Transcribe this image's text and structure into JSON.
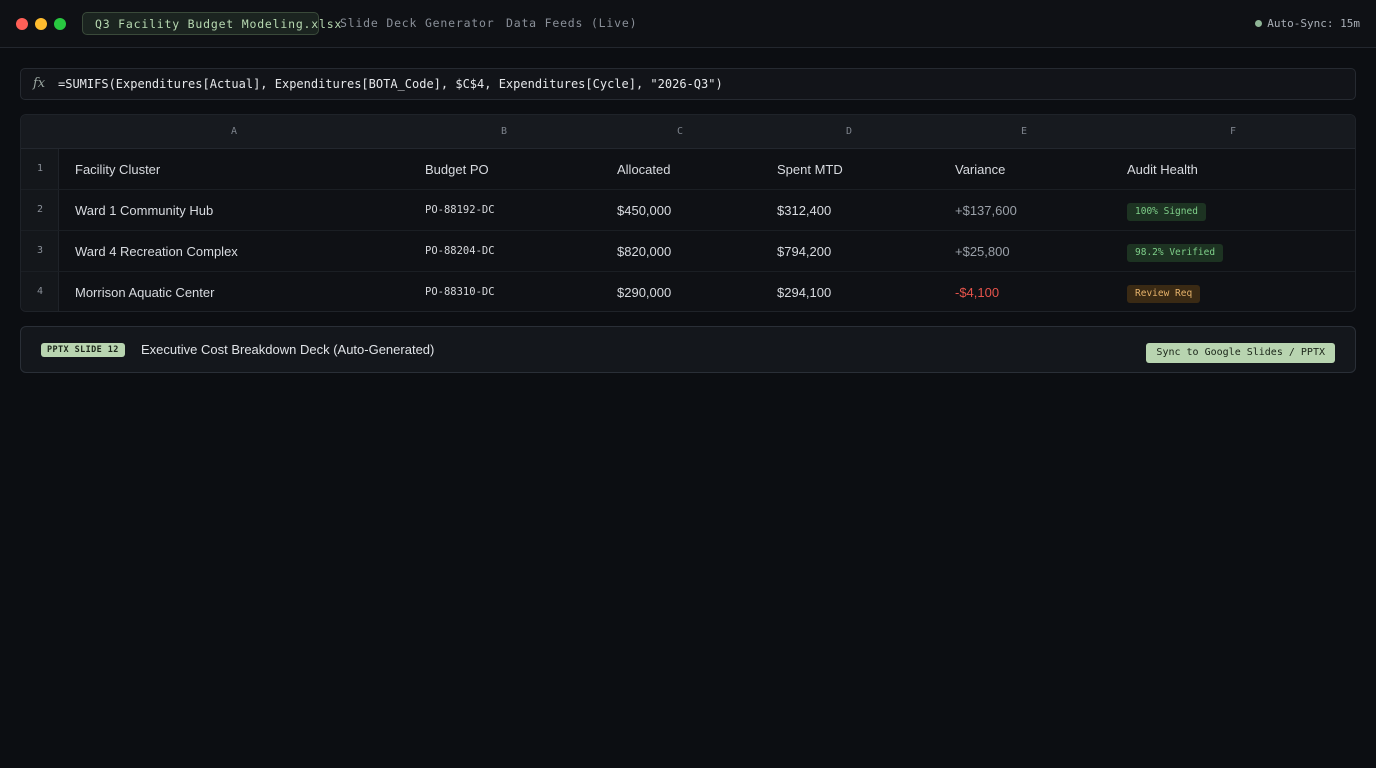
{
  "window": {
    "tabs": [
      {
        "label": "Q3 Facility Budget Modeling.xlsx",
        "active": true
      },
      {
        "label": "Slide Deck Generator",
        "active": false
      },
      {
        "label": "Data Feeds (Live)",
        "active": false
      }
    ],
    "autosync_label": "Auto-Sync: 15m"
  },
  "formula_bar": {
    "fx_label": "fx",
    "formula": "=SUMIFS(Expenditures[Actual], Expenditures[BOTA_Code], $C$4, Expenditures[Cycle], \"2026-Q3\")"
  },
  "grid": {
    "column_letters": [
      "A",
      "B",
      "C",
      "D",
      "E",
      "F"
    ],
    "row_numbers": [
      "1",
      "2",
      "3",
      "4"
    ],
    "header_row": [
      "Facility Cluster",
      "Budget PO",
      "Allocated",
      "Spent MTD",
      "Variance",
      "Audit Health"
    ],
    "rows": [
      {
        "facility": "Ward 1 Community Hub",
        "po": "PO-88192-DC",
        "allocated": "$450,000",
        "spent": "$312,400",
        "variance": "+$137,600",
        "health": "100% Signed"
      },
      {
        "facility": "Ward 4 Recreation Complex",
        "po": "PO-88204-DC",
        "allocated": "$820,000",
        "spent": "$794,200",
        "variance": "+$25,800",
        "health": "98.2% Verified"
      },
      {
        "facility": "Morrison Aquatic Center",
        "po": "PO-88310-DC",
        "allocated": "$290,000",
        "spent": "$294,100",
        "variance": "-$4,100",
        "health": "Review Req"
      }
    ]
  },
  "slide_panel": {
    "tag": "PPTX SLIDE 12",
    "title": "Executive Cost Breakdown Deck (Auto-Generated)",
    "sync_button": "Sync to Google Slides / PPTX"
  },
  "colors": {
    "accent": "#b8d4b0",
    "positive_badge": "#7fd08a",
    "warning_badge": "#e7b36b",
    "negative": "#e5534b",
    "background": "#0c0e12"
  }
}
